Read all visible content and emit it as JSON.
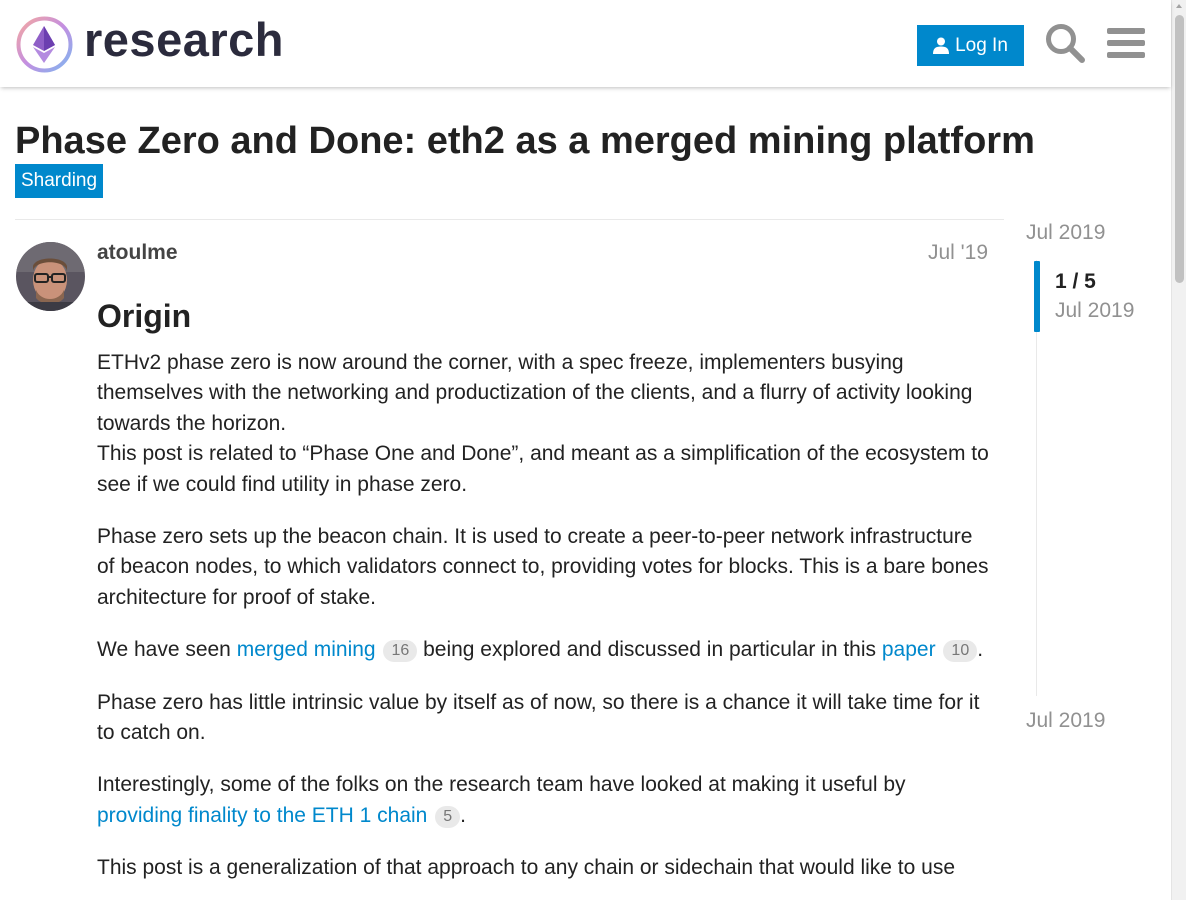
{
  "header": {
    "logo_text": "research",
    "login_label": "Log In",
    "search_icon": "search-icon",
    "menu_icon": "hamburger-menu-icon"
  },
  "topic": {
    "title": "Phase Zero and Done: eth2 as a merged mining platform",
    "category": "Sharding"
  },
  "post": {
    "username": "atoulme",
    "date": "Jul '19",
    "heading": "Origin",
    "p1": "ETHv2 phase zero is now around the corner, with a spec freeze, implementers busying themselves with the networking and productization of the clients, and a flurry of activity looking towards the horizon.",
    "p1b": "This post is related to “Phase One and Done”, and meant as a simplification of the ecosystem to see if we could find utility in phase zero.",
    "p2": "Phase zero sets up the beacon chain. It is used to create a peer-to-peer network infrastructure of beacon nodes, to which validators connect to, providing votes for blocks. This is a bare bones architecture for proof of stake.",
    "p3_pre": "We have seen ",
    "p3_link1": "merged mining",
    "p3_count1": "16",
    "p3_mid": " being explored and discussed in particular in this ",
    "p3_link2": "paper",
    "p3_count2": "10",
    "p3_post": ".",
    "p4": "Phase zero has little intrinsic value by itself as of now, so there is a chance it will take time for it to catch on.",
    "p5_pre": "Interestingly, some of the folks on the research team have looked at making it useful by ",
    "p5_link": "providing finality to the ETH 1 chain",
    "p5_count": "5",
    "p5_post": ".",
    "p6": "This post is a generalization of that approach to any chain or sidechain that would like to use"
  },
  "timeline": {
    "start_date": "Jul 2019",
    "position": "1 / 5",
    "position_date": "Jul 2019",
    "end_date": "Jul 2019"
  },
  "colors": {
    "accent": "#0088cc",
    "muted": "#919191"
  }
}
